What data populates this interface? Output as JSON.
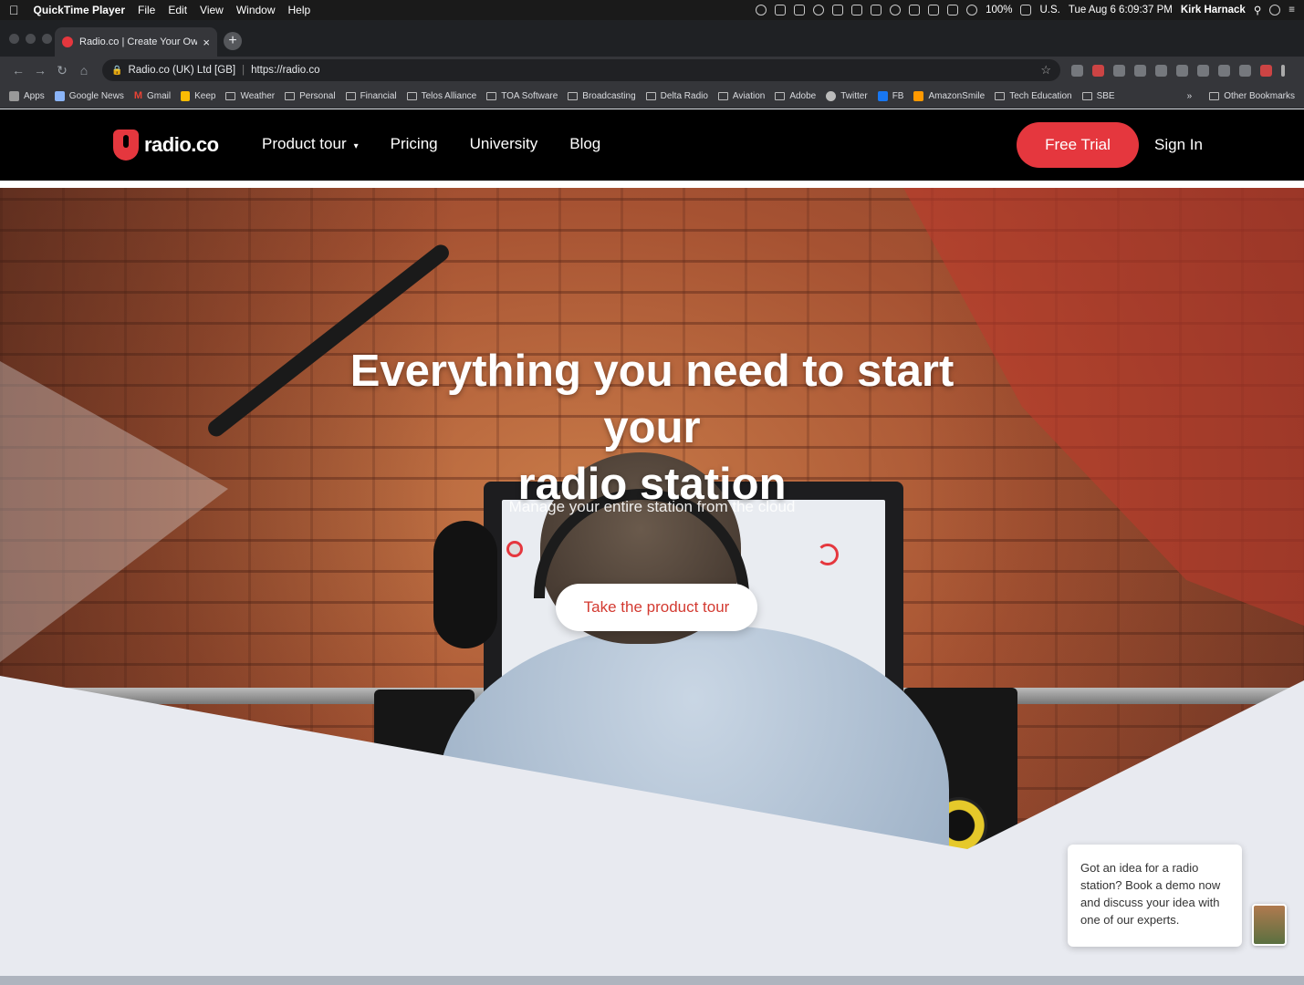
{
  "menubar": {
    "app_name": "QuickTime Player",
    "menus": [
      "File",
      "Edit",
      "View",
      "Window",
      "Help"
    ],
    "battery": "100%",
    "input_source": "U.S.",
    "datetime": "Tue Aug 6  6:09:37 PM",
    "user": "Kirk Harnack"
  },
  "browser": {
    "tab_title": "Radio.co | Create Your Own In",
    "site_identity": "Radio.co (UK) Ltd [GB]",
    "url": "https://radio.co",
    "bookmarks": [
      "Apps",
      "Google News",
      "Gmail",
      "Keep",
      "Weather",
      "Personal",
      "Financial",
      "Telos Alliance",
      "TOA Software",
      "Broadcasting",
      "Delta Radio",
      "Aviation",
      "Adobe",
      "Twitter",
      "FB",
      "AmazonSmile",
      "Tech Education",
      "SBE"
    ],
    "other_bookmarks": "Other Bookmarks"
  },
  "site": {
    "logo": "radio.co",
    "nav": [
      "Product tour",
      "Pricing",
      "University",
      "Blog"
    ],
    "free_trial": "Free Trial",
    "sign_in": "Sign In"
  },
  "hero": {
    "headline_line1": "Everything you need to start your",
    "headline_line2": "radio station",
    "subline": "Manage your entire station from the cloud",
    "cta": "Take the product tour"
  },
  "chat": {
    "message": "Got an idea for a radio station? Book a demo now and discuss your idea with one of our experts."
  },
  "colors": {
    "brand_red": "#e5373e",
    "header_bg": "#000000"
  }
}
